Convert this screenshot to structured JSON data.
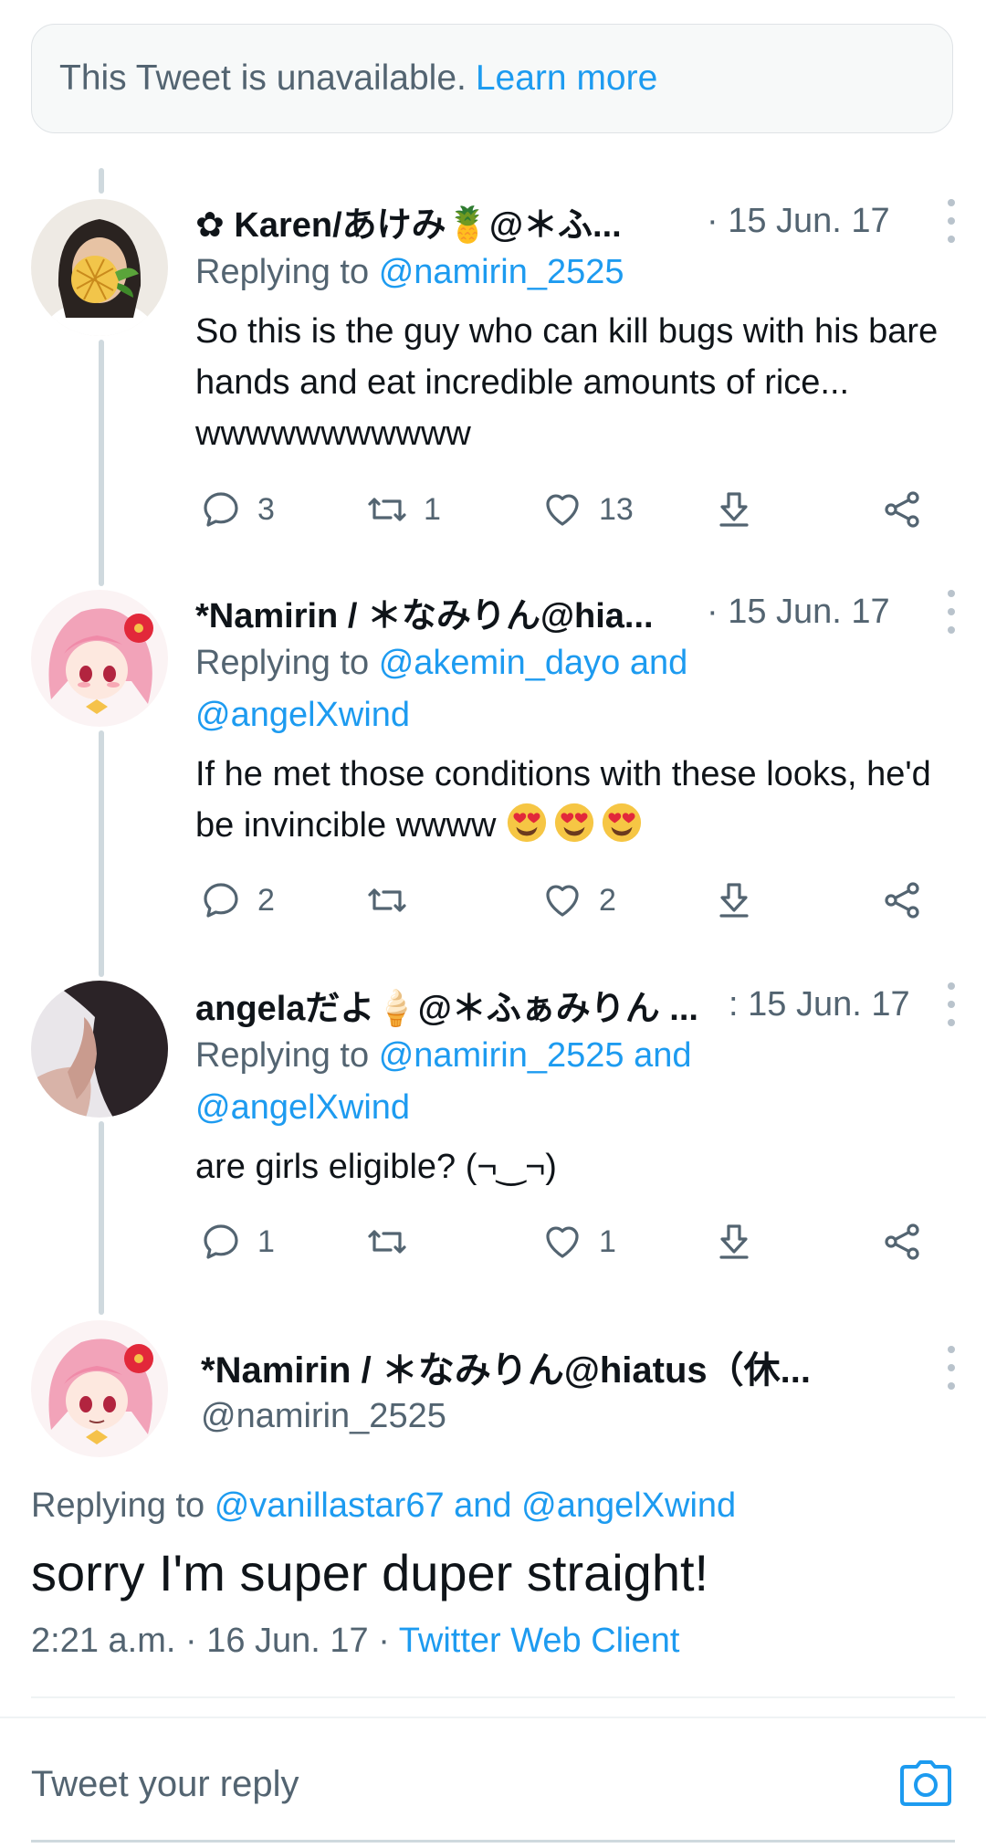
{
  "unavailable": {
    "text": "This Tweet is unavailable.",
    "link": "Learn more"
  },
  "tweets": [
    {
      "name": "✿ Karen/あけみ🍍@＊ふ...",
      "date": "· 15 Jun. 17",
      "replying_label": "Replying to",
      "replying_to": "@namirin_2525",
      "text": "So this is the guy who can kill bugs with his bare hands and eat incredible amounts of rice... wwwwwwwwwww",
      "replies": "3",
      "retweets": "1",
      "likes": "13"
    },
    {
      "name": "*Namirin / ＊なみりん@hia...",
      "date": "· 15 Jun. 17",
      "replying_label": "Replying to",
      "replying_to": "@akemin_dayo and @angelXwind",
      "text": "If he met those conditions with these looks, he'd be invincible wwww",
      "replies": "2",
      "retweets": "",
      "likes": "2"
    },
    {
      "name": "angelaだよ🍦@＊ふぁみりん ...",
      "date": ": 15 Jun. 17",
      "replying_label": "Replying to",
      "replying_to": "@namirin_2525 and @angelXwind",
      "text": "are girls eligible? (¬‿¬)",
      "replies": "1",
      "retweets": "",
      "likes": "1"
    }
  ],
  "main_tweet": {
    "name": "*Namirin / ＊なみりん@hiatus（休...",
    "handle": "@namirin_2525",
    "replying_label": "Replying to",
    "replying_to": "@vanillastar67 and @angelXwind",
    "text": "sorry I'm super duper straight!",
    "time_date": "2:21 a.m. · 16 Jun. 17 ·",
    "client": "Twitter Web Client"
  },
  "reply_box": {
    "placeholder": "Tweet your reply"
  },
  "colors": {
    "accent": "#1d9bf0",
    "secondary_text": "#536471",
    "thread_line": "#cfd9de"
  }
}
